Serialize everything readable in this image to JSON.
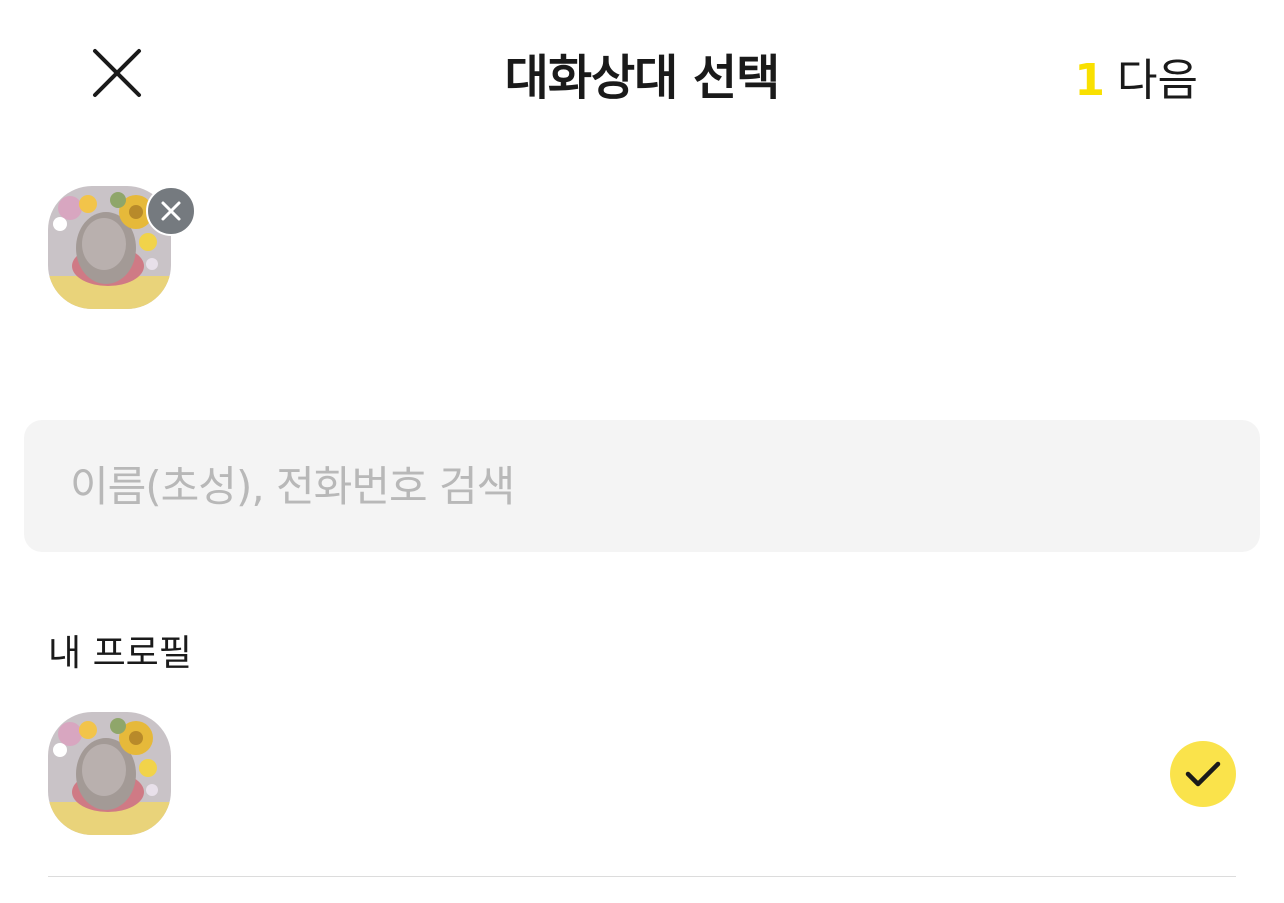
{
  "header": {
    "title": "대화상대 선택",
    "selected_count": "1",
    "next_label": "다음"
  },
  "search": {
    "placeholder": "이름(초성), 전화번호 검색",
    "value": ""
  },
  "sections": {
    "my_profile_label": "내 프로필"
  },
  "colors": {
    "accent_yellow": "#fae34b",
    "count_yellow": "#f9e000",
    "remove_gray": "#757a7f",
    "search_bg": "#f4f4f4"
  },
  "icons": {
    "close": "close-icon",
    "remove": "remove-icon",
    "check": "check-icon"
  }
}
